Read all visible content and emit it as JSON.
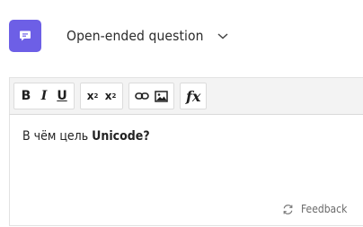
{
  "header": {
    "question_type_icon": "chat-bubble-icon",
    "question_type_label": "Open-ended question",
    "dropdown_icon": "chevron-down-icon"
  },
  "toolbar": {
    "bold": "B",
    "italic": "I",
    "underline": "U",
    "superscript": "x",
    "subscript": "x",
    "superscript_mark": "2",
    "subscript_mark": "2",
    "link_icon": "link-icon",
    "image_icon": "image-icon",
    "formula": "fx"
  },
  "editor": {
    "question_text_plain": "В чём цель ",
    "question_text_bold": "Unicode?"
  },
  "feedback": {
    "label": "Feedback",
    "icon": "refresh-icon"
  },
  "colors": {
    "accent": "#6c5ce7",
    "toolbar_bg": "#f3f3f3"
  }
}
